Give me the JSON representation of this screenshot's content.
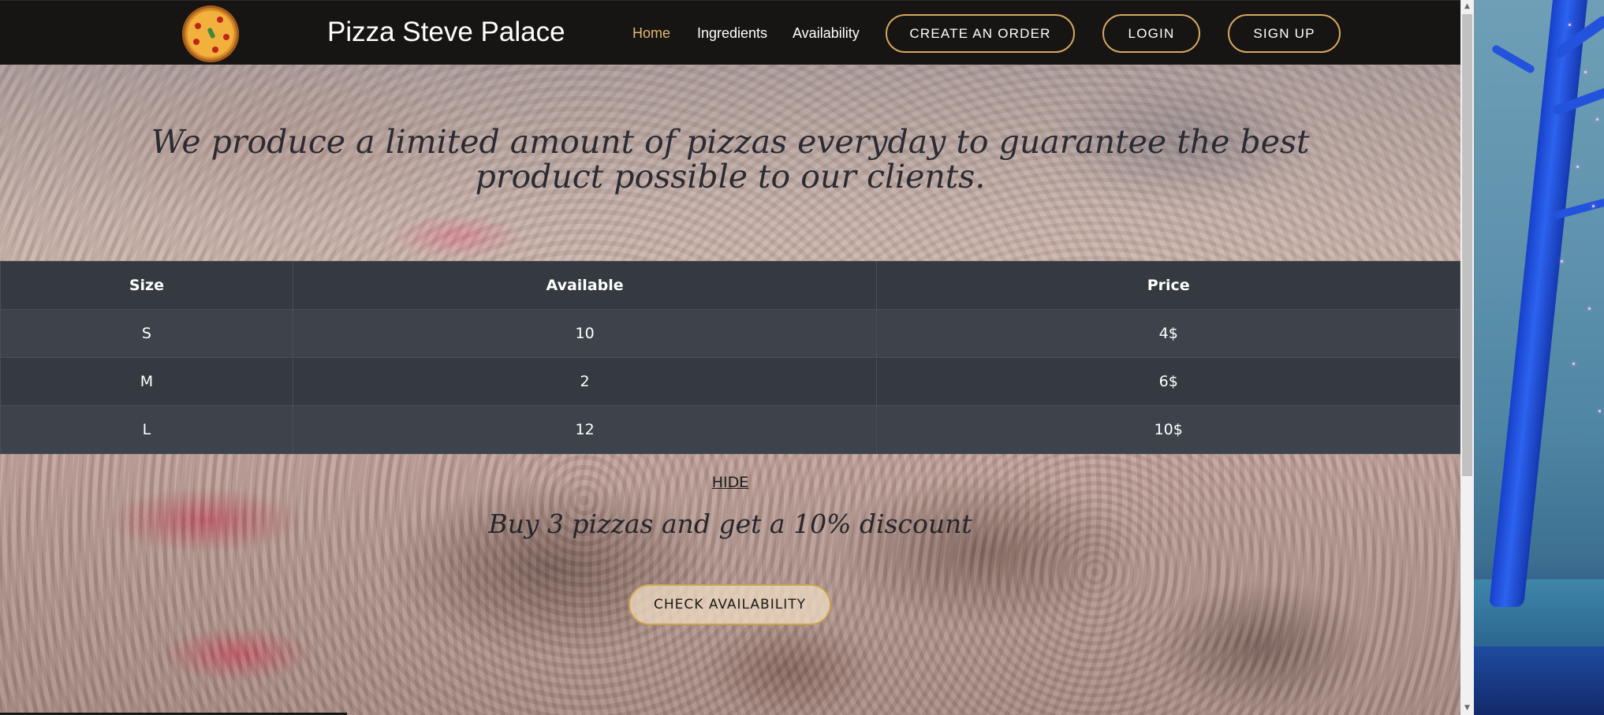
{
  "navbar": {
    "site_title": "Pizza Steve Palace",
    "links": [
      "Home",
      "Ingredients",
      "Availability"
    ],
    "active_link": "Home",
    "buttons": {
      "create_order": "CREATE AN ORDER",
      "login": "LOGIN",
      "signup": "SIGN UP"
    }
  },
  "hero": {
    "text": "We produce a limited amount of pizzas everyday to guarantee the best product possible to our clients."
  },
  "availability_table": {
    "headers": [
      "Size",
      "Available",
      "Price"
    ],
    "rows": [
      [
        "S",
        "10",
        "4$"
      ],
      [
        "M",
        "2",
        "6$"
      ],
      [
        "L",
        "12",
        "10$"
      ]
    ]
  },
  "lower": {
    "hide_link": "HIDE",
    "discount_text": "Buy 3 pizzas and get a 10% discount",
    "check_button": "CHECK AVAILABILITY"
  },
  "scrollbar": {
    "up_icon": "scroll-up-arrow",
    "down_icon": "scroll-down-arrow"
  },
  "colors": {
    "nav_bg": "#171513",
    "accent_gold": "#d6a860",
    "active_link": "#e2b874",
    "table_dark": "#343a40",
    "table_light": "#3e434b"
  }
}
